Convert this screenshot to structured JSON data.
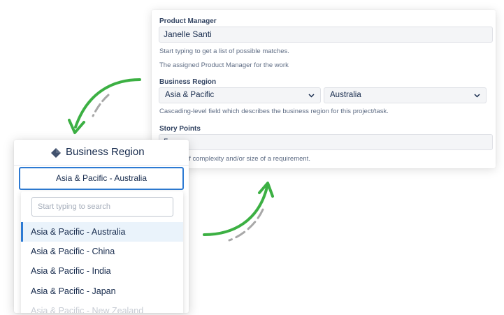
{
  "form": {
    "product_manager": {
      "label": "Product Manager",
      "value": "Janelle Santi",
      "help_1": "Start typing to get a list of possible matches.",
      "help_2": "The assigned Product Manager for the work"
    },
    "business_region": {
      "label": "Business Region",
      "region_value": "Asia & Pacific",
      "country_value": "Australia",
      "help": "Cascading-level field which describes the business region for this project/task."
    },
    "story_points": {
      "label": "Story Points",
      "value": "5",
      "help": "...ement of complexity and/or size of a requirement."
    }
  },
  "dropdown": {
    "title": "Business Region",
    "selected": "Asia & Pacific - Australia",
    "search_placeholder": "Start typing to search",
    "options": [
      "Asia & Pacific - Australia",
      "Asia & Pacific - China",
      "Asia & Pacific - India",
      "Asia & Pacific - Japan",
      "Asia & Pacific - New Zealand"
    ]
  },
  "colors": {
    "accent": "#2d7ad3",
    "arrow_green": "#3cb043",
    "arrow_gray": "#a8a8a8"
  },
  "icons": {
    "title_icon": "diamond-icon",
    "select_chevron": "chevron-down-icon"
  }
}
